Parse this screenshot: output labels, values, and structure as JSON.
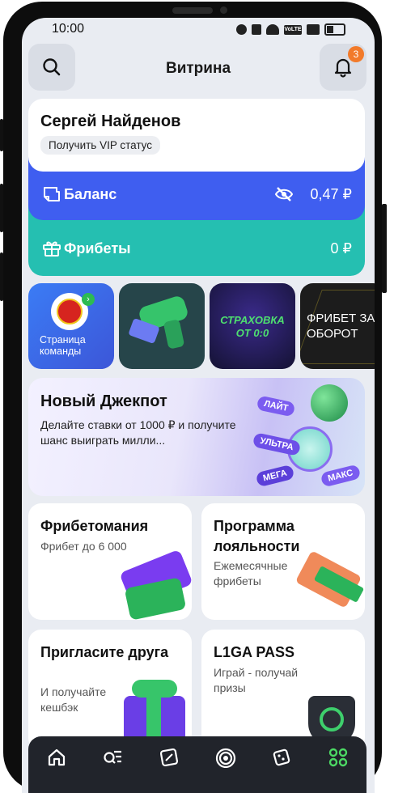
{
  "status": {
    "time": "10:00",
    "volte": "VoLTE"
  },
  "header": {
    "title": "Витрина",
    "notifications_count": "3"
  },
  "user": {
    "name": "Сергей Найденов",
    "vip_label": "Получить VIP статус",
    "balance_label": "Баланс",
    "balance_value": "0,47 ₽",
    "freebets_label": "Фрибеты",
    "freebets_value": "0 ₽"
  },
  "stories": [
    {
      "label": "Страница команды"
    },
    {
      "label": ""
    },
    {
      "label": "СТРАХОВКА ОТ 0:0"
    },
    {
      "label": "ФРИБЕТ ЗА ОБОРОТ"
    }
  ],
  "jackpot": {
    "title": "Новый Джекпот",
    "description": "Делайте ставки от 1000 ₽ и получите шанс выиграть милли...",
    "tiers": [
      "ЛАЙТ",
      "УЛЬТРА",
      "МЕГА",
      "МАКС"
    ]
  },
  "cards": [
    {
      "title": "Фрибетомания",
      "desc": "Фрибет до 6 000"
    },
    {
      "title": "Программа лояльности",
      "desc": "Ежемесячные фрибеты"
    },
    {
      "title": "Пригласите друга",
      "desc": "И получайте кешбэк"
    },
    {
      "title": "L1GA PASS",
      "desc": "Играй - получай призы"
    }
  ],
  "colors": {
    "balance": "#3f5ef0",
    "freebets": "#25bfb1",
    "badge": "#f27a2a",
    "active_tab": "#4cd964"
  },
  "tabs": [
    "home-icon",
    "search-list-icon",
    "coupon-icon",
    "live-icon",
    "casino-icon",
    "showcase-grid-icon"
  ]
}
